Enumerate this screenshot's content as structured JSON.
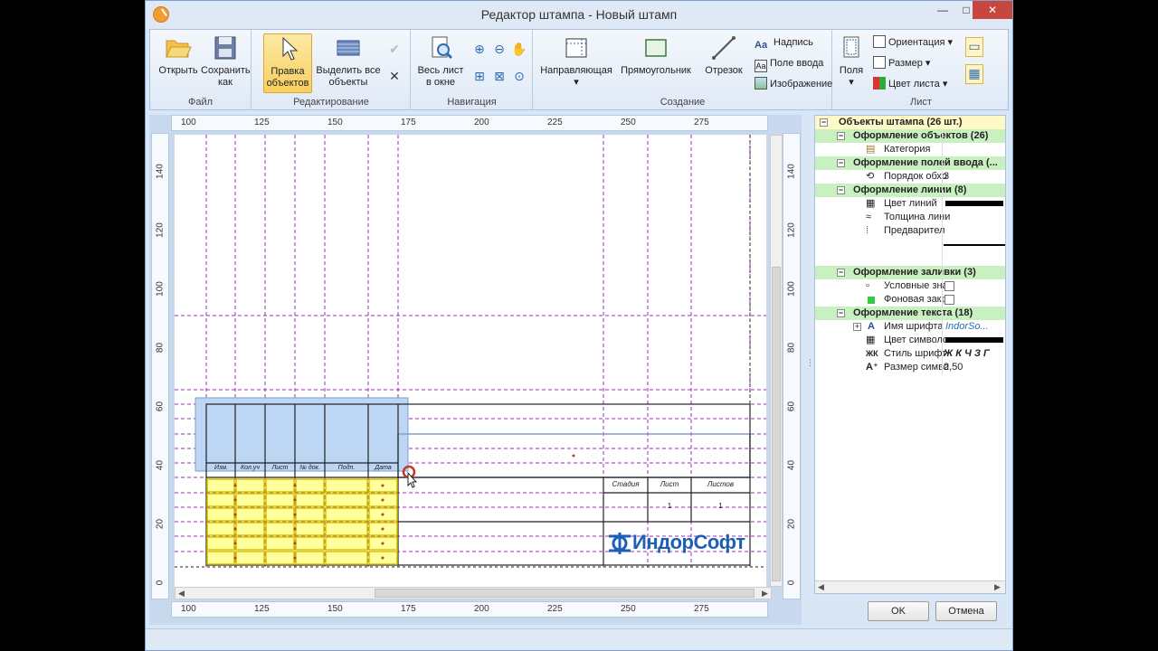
{
  "window": {
    "title": "Редактор штампа - Новый штамп",
    "minimize": "—",
    "maximize": "□",
    "close": "✕"
  },
  "ribbon": {
    "file": {
      "label": "Файл",
      "open": "Открыть",
      "save_as_1": "Сохранить",
      "save_as_2": "как"
    },
    "edit": {
      "label": "Редактирование",
      "edit_obj_1": "Правка",
      "edit_obj_2": "объектов",
      "select_all_1": "Выделить все",
      "select_all_2": "объекты"
    },
    "nav": {
      "label": "Навигация",
      "fit_1": "Весь лист",
      "fit_2": "в окне"
    },
    "create": {
      "label": "Создание",
      "guide": "Направляющая",
      "rect": "Прямоугольник",
      "segment": "Отрезок",
      "caption": "Надпись",
      "input": "Поле ввода",
      "image": "Изображение"
    },
    "sheet": {
      "label": "Лист",
      "fields": "Поля",
      "orientation": "Ориентация",
      "size": "Размер",
      "color": "Цвет листа"
    }
  },
  "rulers": {
    "horizontal": [
      "100",
      "125",
      "150",
      "175",
      "200",
      "225",
      "250",
      "275"
    ],
    "vertical": [
      "140",
      "120",
      "100",
      "80",
      "60",
      "40",
      "20",
      "0"
    ]
  },
  "stamp": {
    "column_heads": [
      "Изм.",
      "Кол.уч",
      "Лист",
      "№ док.",
      "Подп.",
      "Дата"
    ],
    "right_heads": [
      "Стадия",
      "Лист",
      "Листов"
    ],
    "right_values": [
      "1",
      "1"
    ],
    "logo": "ИндорСофт"
  },
  "properties": {
    "root": "Объекты штампа (26 шт.)",
    "cat_objects": "Оформление объектов (26)",
    "category": "Категория",
    "cat_fields": "Оформление полей ввода (...",
    "bypass": "Порядок обхо",
    "bypass_val": "3",
    "cat_lines": "Оформление линии (8)",
    "line_color": "Цвет линий",
    "line_width": "Толщина лини",
    "preview": "Предварител",
    "cat_fill": "Оформление заливки (3)",
    "conventional": "Условные зна",
    "background": "Фоновая закр",
    "cat_text": "Оформление текста (18)",
    "font_name": "Имя шрифта",
    "font_val": "IndorSo...",
    "font_color": "Цвет символо",
    "font_style": "Стиль шрифт",
    "style_val": "Ж К Ч З Г",
    "font_size": "Размер симво",
    "size_val": "2,50"
  },
  "dialog": {
    "ok": "OK",
    "cancel": "Отмена"
  },
  "colors": {
    "selection": "#bcd6f4",
    "input_fill": "#ffff9c",
    "guide": "#9a32b3",
    "category_bg": "#c9f0c0"
  }
}
